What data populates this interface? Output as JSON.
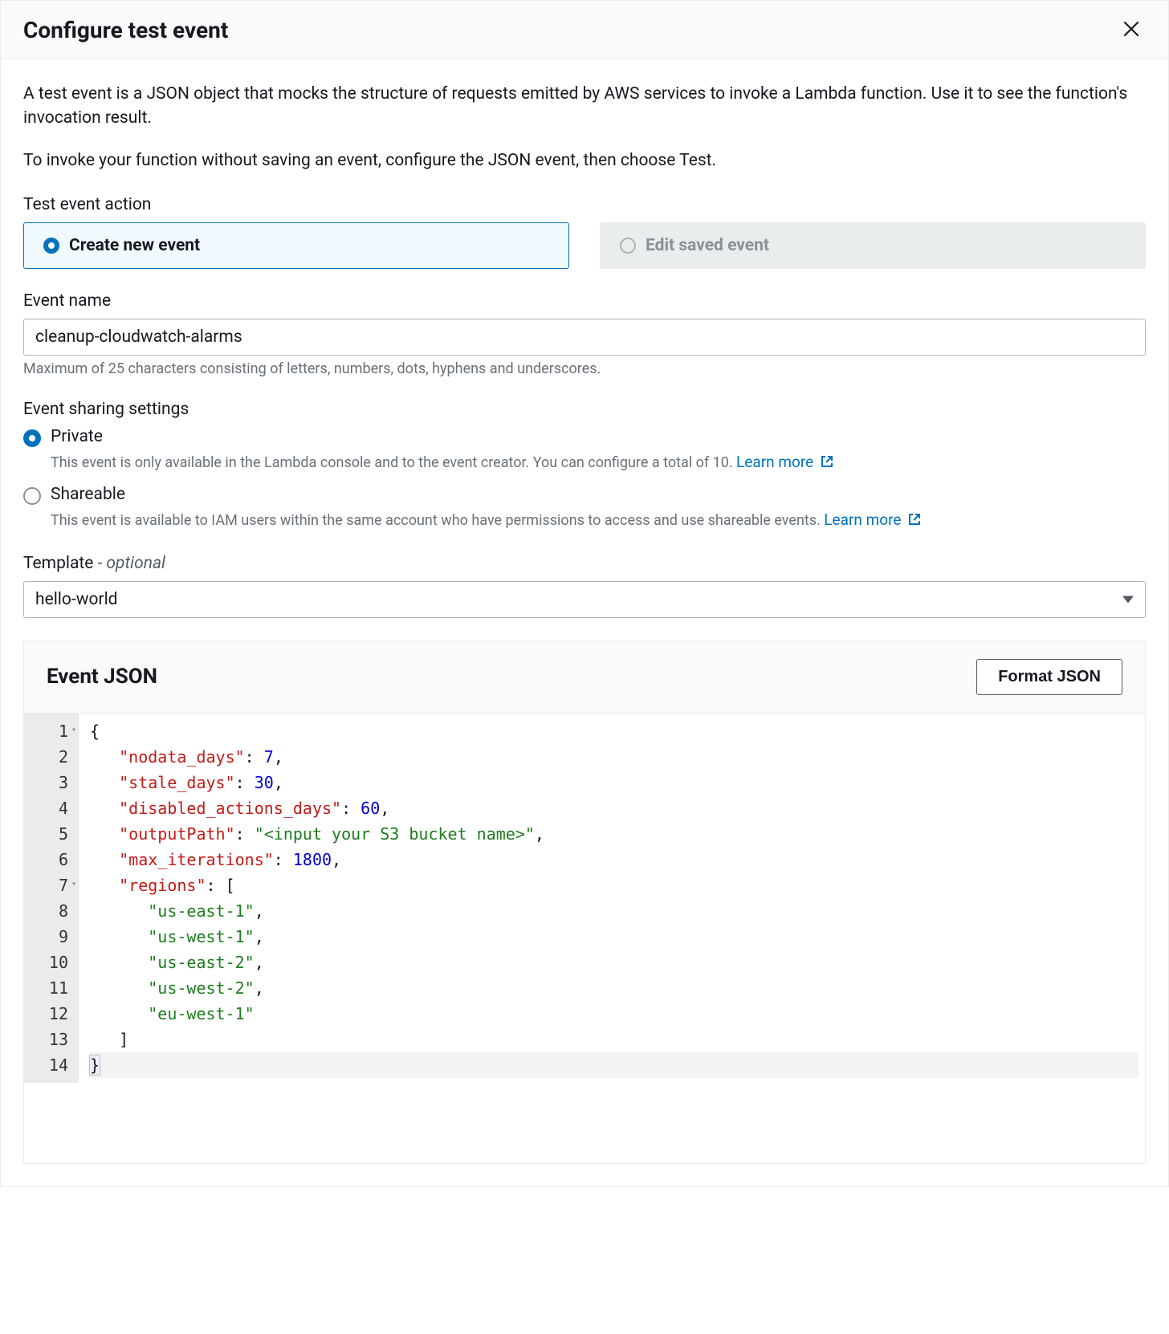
{
  "modal": {
    "title": "Configure test event",
    "intro1": "A test event is a JSON object that mocks the structure of requests emitted by AWS services to invoke a Lambda function. Use it to see the function's invocation result.",
    "intro2": "To invoke your function without saving an event, configure the JSON event, then choose Test."
  },
  "testEventAction": {
    "label": "Test event action",
    "createNew": "Create new event",
    "editSaved": "Edit saved event"
  },
  "eventName": {
    "label": "Event name",
    "value": "cleanup-cloudwatch-alarms",
    "helper": "Maximum of 25 characters consisting of letters, numbers, dots, hyphens and underscores."
  },
  "sharing": {
    "label": "Event sharing settings",
    "private": {
      "label": "Private",
      "desc": "This event is only available in the Lambda console and to the event creator. You can configure a total of 10.",
      "learnMore": "Learn more"
    },
    "shareable": {
      "label": "Shareable",
      "desc": "This event is available to IAM users within the same account who have permissions to access and use shareable events.",
      "learnMore": "Learn more"
    }
  },
  "template": {
    "label": "Template",
    "optionalTag": "- optional",
    "selected": "hello-world"
  },
  "jsonPanel": {
    "title": "Event JSON",
    "formatBtn": "Format JSON"
  },
  "code": {
    "lines": [
      {
        "no": "1",
        "fold": true,
        "indent": 0,
        "tokens": [
          {
            "t": "p",
            "v": "{"
          }
        ]
      },
      {
        "no": "2",
        "indent": 1,
        "tokens": [
          {
            "t": "k",
            "v": "\"nodata_days\""
          },
          {
            "t": "p",
            "v": ": "
          },
          {
            "t": "n",
            "v": "7"
          },
          {
            "t": "p",
            "v": ","
          }
        ]
      },
      {
        "no": "3",
        "indent": 1,
        "tokens": [
          {
            "t": "k",
            "v": "\"stale_days\""
          },
          {
            "t": "p",
            "v": ": "
          },
          {
            "t": "n",
            "v": "30"
          },
          {
            "t": "p",
            "v": ","
          }
        ]
      },
      {
        "no": "4",
        "indent": 1,
        "tokens": [
          {
            "t": "k",
            "v": "\"disabled_actions_days\""
          },
          {
            "t": "p",
            "v": ": "
          },
          {
            "t": "n",
            "v": "60"
          },
          {
            "t": "p",
            "v": ","
          }
        ]
      },
      {
        "no": "5",
        "indent": 1,
        "tokens": [
          {
            "t": "k",
            "v": "\"outputPath\""
          },
          {
            "t": "p",
            "v": ": "
          },
          {
            "t": "s",
            "v": "\"<input your S3 bucket name>\""
          },
          {
            "t": "p",
            "v": ","
          }
        ]
      },
      {
        "no": "6",
        "indent": 1,
        "tokens": [
          {
            "t": "k",
            "v": "\"max_iterations\""
          },
          {
            "t": "p",
            "v": ": "
          },
          {
            "t": "n",
            "v": "1800"
          },
          {
            "t": "p",
            "v": ","
          }
        ]
      },
      {
        "no": "7",
        "fold": true,
        "indent": 1,
        "tokens": [
          {
            "t": "k",
            "v": "\"regions\""
          },
          {
            "t": "p",
            "v": ": ["
          }
        ]
      },
      {
        "no": "8",
        "indent": 2,
        "tokens": [
          {
            "t": "s",
            "v": "\"us-east-1\""
          },
          {
            "t": "p",
            "v": ","
          }
        ]
      },
      {
        "no": "9",
        "indent": 2,
        "tokens": [
          {
            "t": "s",
            "v": "\"us-west-1\""
          },
          {
            "t": "p",
            "v": ","
          }
        ]
      },
      {
        "no": "10",
        "indent": 2,
        "tokens": [
          {
            "t": "s",
            "v": "\"us-east-2\""
          },
          {
            "t": "p",
            "v": ","
          }
        ]
      },
      {
        "no": "11",
        "indent": 2,
        "tokens": [
          {
            "t": "s",
            "v": "\"us-west-2\""
          },
          {
            "t": "p",
            "v": ","
          }
        ]
      },
      {
        "no": "12",
        "indent": 2,
        "tokens": [
          {
            "t": "s",
            "v": "\"eu-west-1\""
          }
        ]
      },
      {
        "no": "13",
        "indent": 1,
        "tokens": [
          {
            "t": "p",
            "v": "]"
          }
        ]
      },
      {
        "no": "14",
        "indent": 0,
        "hl": true,
        "tokens": [
          {
            "t": "p",
            "v": "}",
            "braceHl": true
          }
        ]
      }
    ]
  }
}
